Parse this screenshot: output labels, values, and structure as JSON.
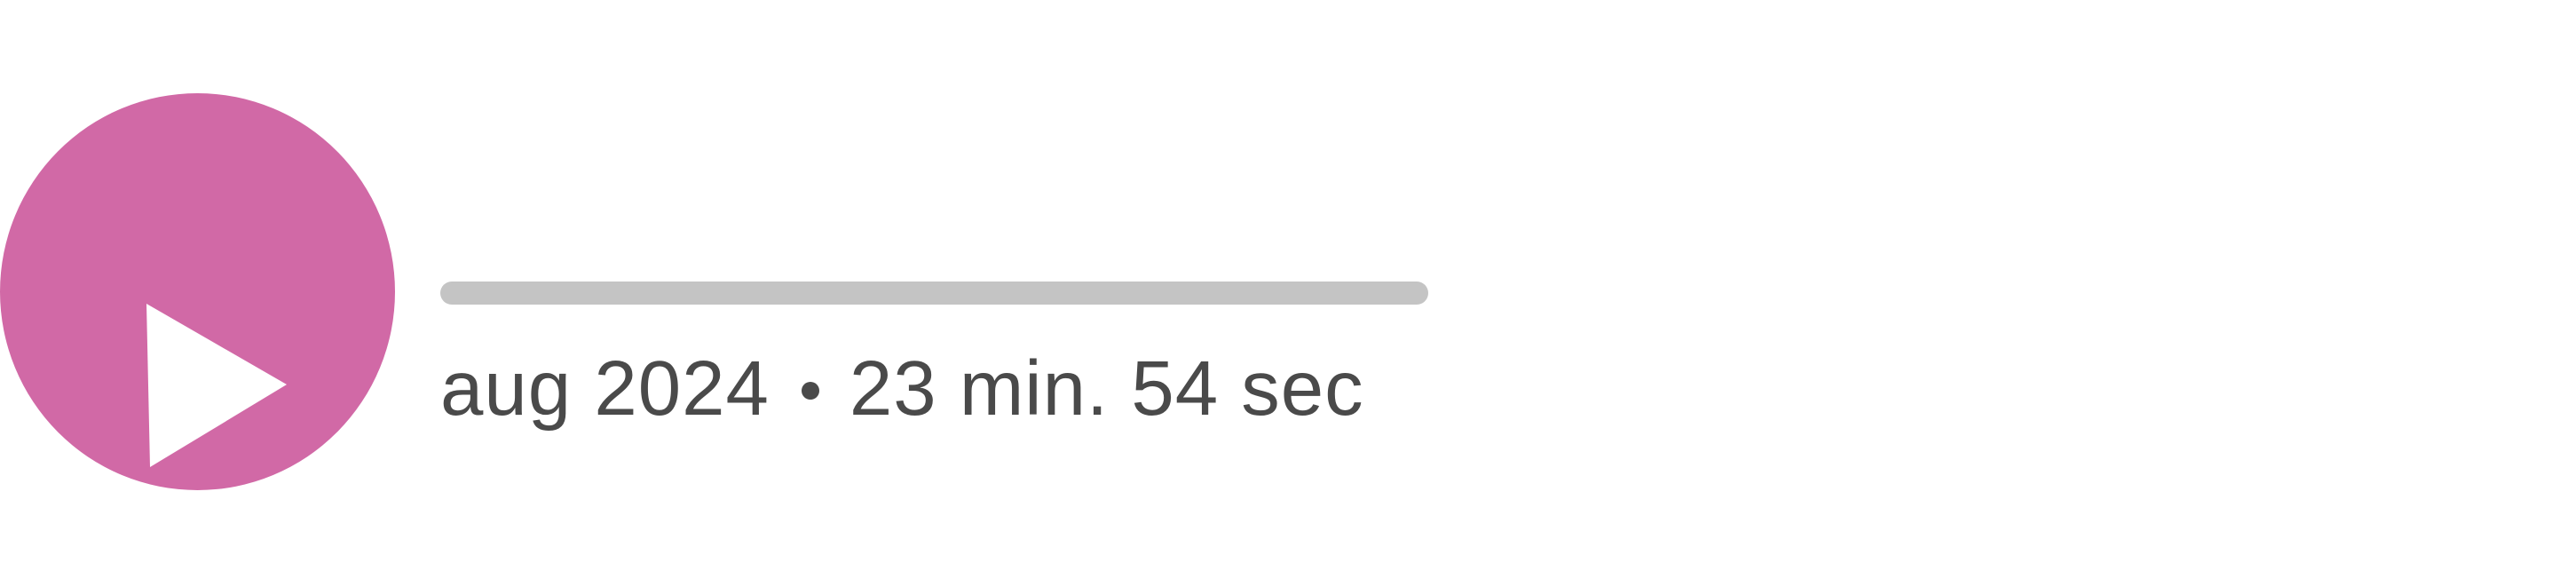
{
  "player": {
    "play_icon": "play-icon",
    "accent_color": "#d169a6",
    "track_color": "#c4c4c4",
    "text_color": "#4a4a4a",
    "progress_fraction": 0
  },
  "meta": {
    "date": "aug 2024",
    "duration": "23 min. 54 sec"
  }
}
